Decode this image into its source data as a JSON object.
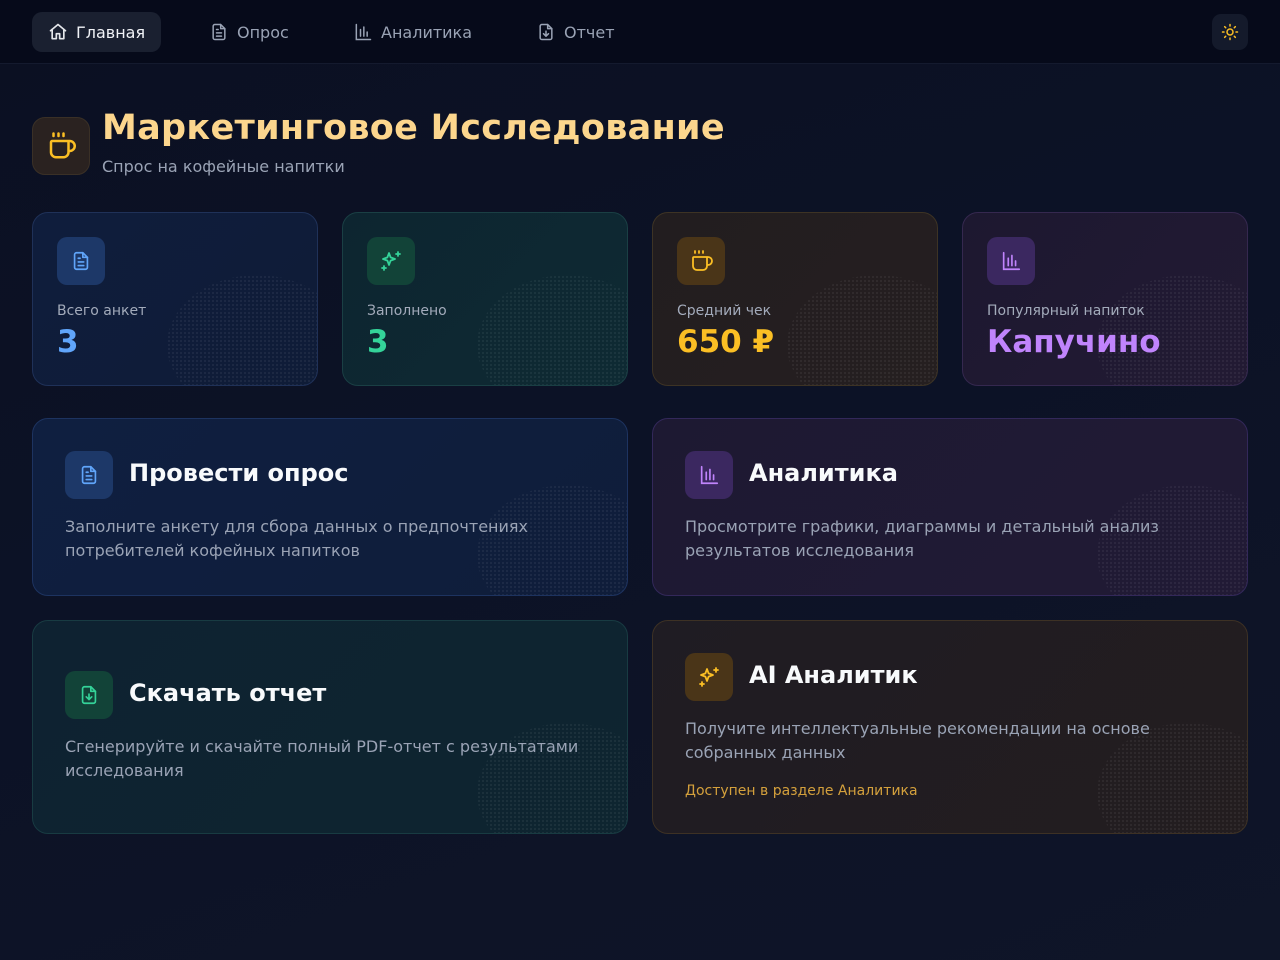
{
  "nav": {
    "items": [
      {
        "label": "Главная",
        "icon": "home-icon",
        "active": true
      },
      {
        "label": "Опрос",
        "icon": "document-icon",
        "active": false
      },
      {
        "label": "Аналитика",
        "icon": "bar-chart-icon",
        "active": false
      },
      {
        "label": "Отчет",
        "icon": "file-download-icon",
        "active": false
      }
    ],
    "theme_toggle_icon": "sun-icon"
  },
  "header": {
    "title": "Маркетинговое Исследование",
    "subtitle": "Спрос на кофейные напитки",
    "icon": "coffee-cup-icon"
  },
  "stats": [
    {
      "label": "Всего анкет",
      "value": "3",
      "icon": "document-icon",
      "color": "#60a5fa"
    },
    {
      "label": "Заполнено",
      "value": "3",
      "icon": "sparkles-icon",
      "color": "#34d399"
    },
    {
      "label": "Средний чек",
      "value": "650 ₽",
      "icon": "coffee-cup-icon",
      "color": "#fbbf24"
    },
    {
      "label": "Популярный напиток",
      "value": "Капучино",
      "icon": "bar-chart-icon",
      "color": "#c084fc"
    }
  ],
  "actions": [
    {
      "title": "Провести опрос",
      "description": "Заполните анкету для сбора данных о предпочтениях потребителей кофейных напитков",
      "icon": "document-icon"
    },
    {
      "title": "Аналитика",
      "description": "Просмотрите графики, диаграммы и детальный анализ результатов исследования",
      "icon": "bar-chart-icon"
    },
    {
      "title": "Скачать отчет",
      "description": "Сгенерируйте и скачайте полный PDF-отчет с результатами исследования",
      "icon": "file-download-icon"
    },
    {
      "title": "AI Аналитик",
      "description": "Получите интеллектуальные рекомендации на основе собранных данных",
      "note": "Доступен в разделе Аналитика",
      "icon": "sparkles-icon"
    }
  ]
}
